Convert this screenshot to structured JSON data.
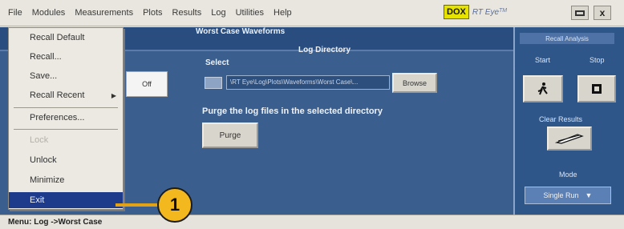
{
  "menubar": {
    "items": [
      "File",
      "Modules",
      "Measurements",
      "Plots",
      "Results",
      "Log",
      "Utilities",
      "Help"
    ],
    "brand_badge": "DOX",
    "brand_name": "RT Eye",
    "brand_sup": "TM",
    "icon_label": "x"
  },
  "dropdown": {
    "items": [
      {
        "label": "Recall Default",
        "enabled": true
      },
      {
        "label": "Recall...",
        "enabled": true
      },
      {
        "label": "Save...",
        "enabled": true
      },
      {
        "label": "Recall Recent",
        "enabled": true,
        "submenu": "▶"
      },
      {
        "label": "Preferences...",
        "enabled": true
      },
      {
        "label": "Lock",
        "enabled": false
      },
      {
        "label": "Unlock",
        "enabled": true
      },
      {
        "label": "Minimize",
        "enabled": true
      },
      {
        "label": "Exit",
        "enabled": true,
        "highlighted": true
      }
    ]
  },
  "main": {
    "worst_case_title": "Worst Case Waveforms",
    "log_directory": "Log Directory",
    "select_label": "Select",
    "path_value": "\\RT Eye\\Log\\Plots\\Waveforms\\Worst Case\\...",
    "browse_label": "Browse",
    "purge_label": "Purge the log files in the selected directory",
    "purge_button": "Purge",
    "off_button": "Off"
  },
  "right": {
    "recall_analysis": "Recall Analysis",
    "start_label": "Start",
    "stop_label": "Stop",
    "clear_results": "Clear Results",
    "mode_label": "Mode",
    "mode_value": "Single Run",
    "mode_arrow": "▼"
  },
  "status": {
    "text": "Menu: Log ->Worst Case"
  },
  "callout": {
    "number": "1"
  },
  "colors": {
    "panel_blue": "#3a5f8f",
    "highlight_navy": "#1e3a8a",
    "callout_gold": "#f2b81e",
    "brand_yellow": "#e6e300"
  }
}
